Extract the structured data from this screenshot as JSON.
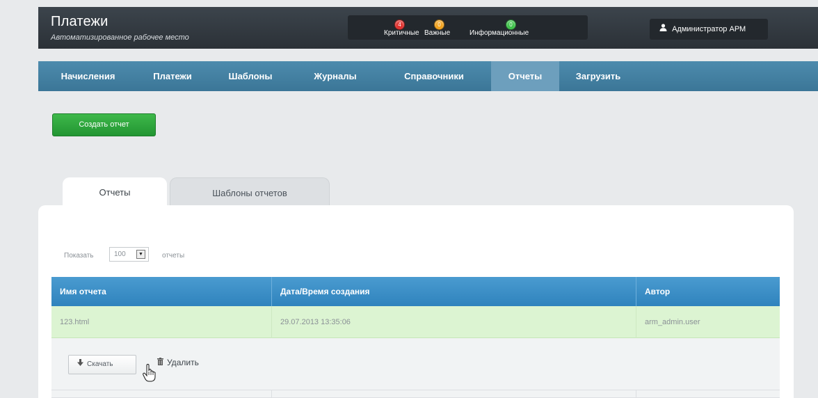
{
  "header": {
    "title": "Платежи",
    "subtitle": "Автоматизированное рабочее место",
    "alerts": [
      {
        "label": "Критичные",
        "count": "4",
        "color": "#e0312e"
      },
      {
        "label": "Важные",
        "count": "0",
        "color": "#f2a21c"
      },
      {
        "label": "Информационные",
        "count": "0",
        "color": "#3ec24a"
      }
    ],
    "user": "Администратор АРМ"
  },
  "nav": {
    "items": [
      "Начисления",
      "Платежи",
      "Шаблоны",
      "Журналы",
      "Справочники",
      "Отчеты",
      "Загрузить"
    ],
    "active": "Отчеты"
  },
  "create_button": "Создать отчет",
  "tabs": [
    "Отчеты",
    "Шаблоны отчетов"
  ],
  "show": {
    "label": "Показать",
    "value": "100",
    "suffix": "отчеты"
  },
  "table": {
    "columns": [
      "Имя отчета",
      "Дата/Время создания",
      "Автор"
    ],
    "rows": [
      {
        "name": "123.html",
        "created": "29.07.2013 13:35:06",
        "author": "arm_admin.user"
      }
    ]
  },
  "actions": {
    "download": "Скачать",
    "delete": "Удалить"
  },
  "icons": {
    "user": "user-icon",
    "download": "download-icon",
    "delete": "trash-icon",
    "select": "chevron-down-icon",
    "cursor": "hand-cursor-icon"
  },
  "colors": {
    "accent_green": "#2aa339",
    "table_header": "#3a8fc8",
    "row_selected": "#dcf4d2",
    "nav": "#4582a4"
  }
}
